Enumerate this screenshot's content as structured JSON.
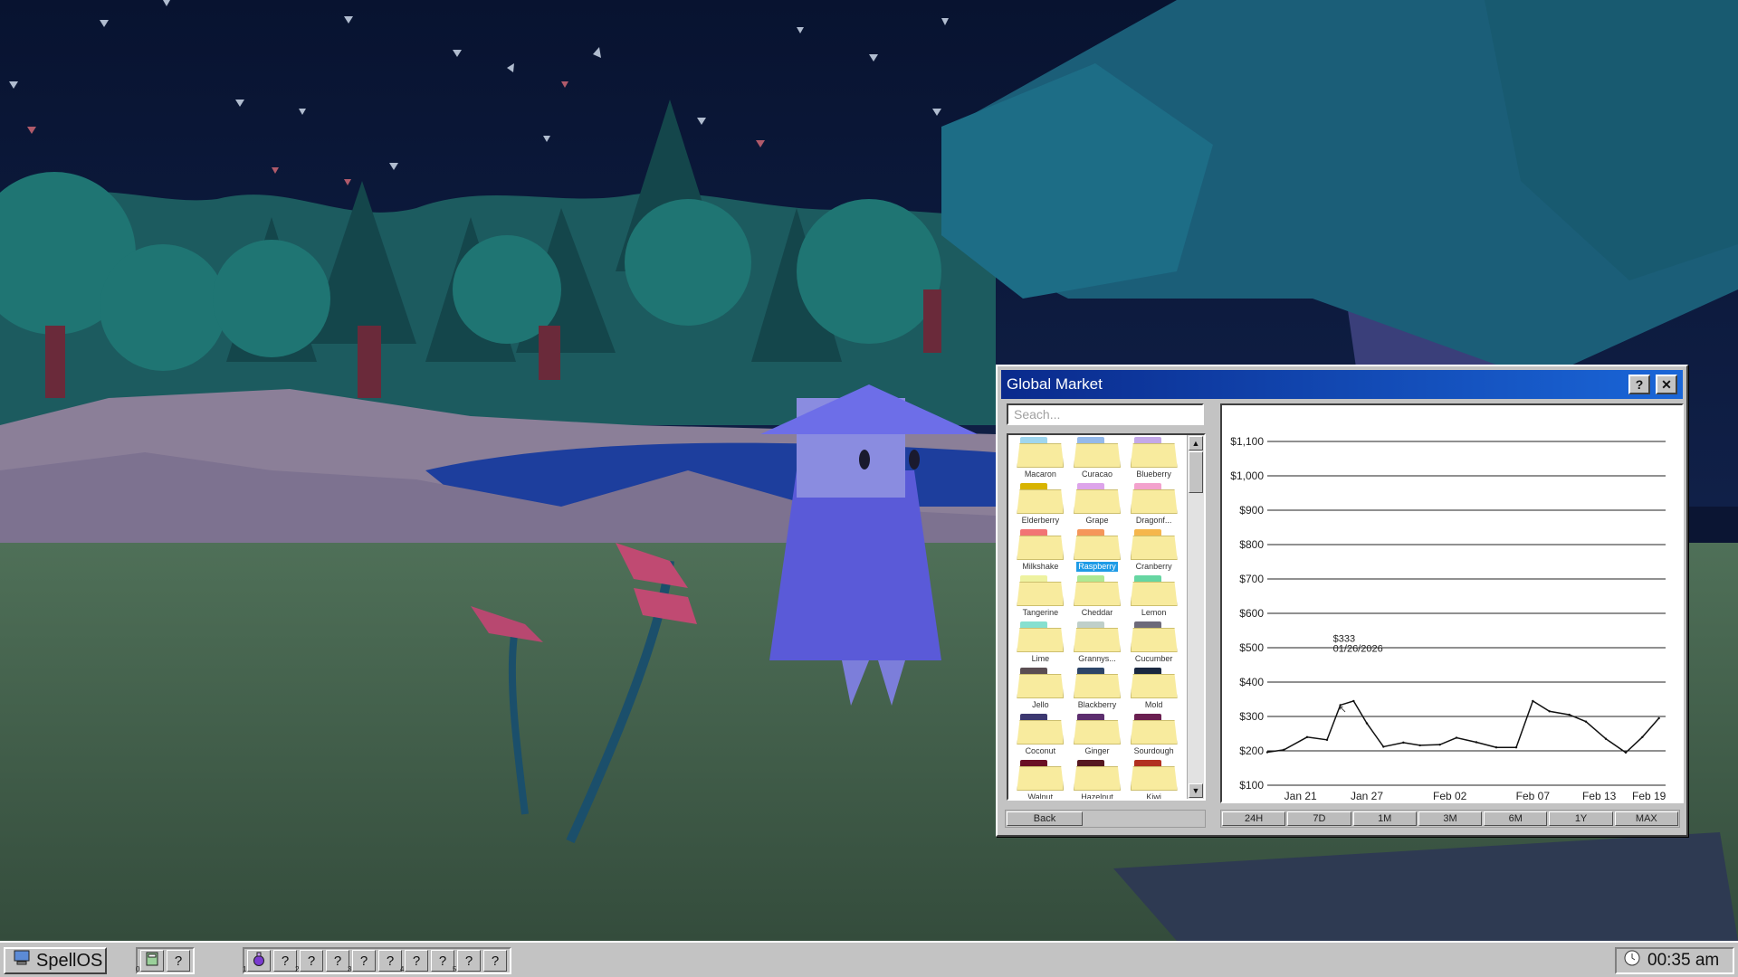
{
  "window": {
    "title": "Global Market",
    "help_label": "?",
    "close_label": "✕",
    "search_placeholder": "Seach...",
    "back_label": "Back",
    "range_buttons": [
      "24H",
      "7D",
      "1M",
      "3M",
      "6M",
      "1Y",
      "MAX"
    ],
    "items": [
      {
        "name": "Macaron",
        "color": "#9fd6ee",
        "selected": false
      },
      {
        "name": "Curacao",
        "color": "#94b9ea",
        "selected": false
      },
      {
        "name": "Blueberry",
        "color": "#c4a8e8",
        "selected": false
      },
      {
        "name": "Elderberry",
        "color": "#d8b400",
        "selected": false
      },
      {
        "name": "Grape",
        "color": "#dda4ea",
        "selected": false
      },
      {
        "name": "Dragonf...",
        "color": "#f3a2cd",
        "selected": false
      },
      {
        "name": "Milkshake",
        "color": "#f27474",
        "selected": false
      },
      {
        "name": "Raspberry",
        "color": "#f5965a",
        "selected": true
      },
      {
        "name": "Cranberry",
        "color": "#f5b64c",
        "selected": false
      },
      {
        "name": "Tangerine",
        "color": "#eef2a0",
        "selected": false
      },
      {
        "name": "Cheddar",
        "color": "#aee892",
        "selected": false
      },
      {
        "name": "Lemon",
        "color": "#66d6a2",
        "selected": false
      },
      {
        "name": "Lime",
        "color": "#86e0d0",
        "selected": false
      },
      {
        "name": "Grannys...",
        "color": "#bfcfc9",
        "selected": false
      },
      {
        "name": "Cucumber",
        "color": "#6d6a7a",
        "selected": false
      },
      {
        "name": "Jello",
        "color": "#5b4e52",
        "selected": false
      },
      {
        "name": "Blackberry",
        "color": "#2d4568",
        "selected": false
      },
      {
        "name": "Mold",
        "color": "#1a2840",
        "selected": false
      },
      {
        "name": "Coconut",
        "color": "#3c3870",
        "selected": false
      },
      {
        "name": "Ginger",
        "color": "#5c2e6e",
        "selected": false
      },
      {
        "name": "Sourdough",
        "color": "#6a1f50",
        "selected": false
      },
      {
        "name": "Walnut",
        "color": "#6a0f25",
        "selected": false
      },
      {
        "name": "Hazelnut",
        "color": "#561820",
        "selected": false
      },
      {
        "name": "Kiwi",
        "color": "#b23020",
        "selected": false
      }
    ]
  },
  "chart_data": {
    "type": "line",
    "y_ticks": [
      100,
      200,
      300,
      400,
      500,
      600,
      700,
      800,
      900,
      1000,
      1100
    ],
    "y_tick_labels": [
      "$100",
      "$200",
      "$300",
      "$400",
      "$500",
      "$600",
      "$700",
      "$800",
      "$900",
      "$1,000",
      "$1,100"
    ],
    "ylim": [
      100,
      1100
    ],
    "x_tick_labels": [
      "Jan 21",
      "Jan 27",
      "Feb 02",
      "Feb 07",
      "Feb 13",
      "Feb 19"
    ],
    "x_tick_positions": [
      1,
      3,
      5.5,
      8,
      10,
      11.5
    ],
    "xlim": [
      0,
      12
    ],
    "x": [
      0,
      0.5,
      1.2,
      1.8,
      2.2,
      2.6,
      3.0,
      3.5,
      4.1,
      4.6,
      5.2,
      5.7,
      6.3,
      6.9,
      7.5,
      8.0,
      8.5,
      9.1,
      9.6,
      10.2,
      10.8,
      11.3,
      11.8
    ],
    "y": [
      196,
      203,
      240,
      232,
      333,
      345,
      280,
      212,
      224,
      216,
      218,
      238,
      225,
      210,
      210,
      345,
      315,
      305,
      285,
      235,
      195,
      240,
      295
    ],
    "tooltip": {
      "value": "$333",
      "date": "01/26/2026",
      "x": 2.2,
      "y": 333
    },
    "grid": true
  },
  "taskbar": {
    "start_label": "SpellOS",
    "group1": [
      {
        "icon": "calculator-icon",
        "label": "",
        "num": "0"
      },
      {
        "icon": "unknown-icon",
        "label": "?",
        "num": ""
      }
    ],
    "slots": [
      {
        "icon": "potion-icon",
        "label": "",
        "num": "1"
      },
      {
        "icon": "unknown-icon",
        "label": "?",
        "num": ""
      },
      {
        "icon": "unknown-icon",
        "label": "?",
        "num": "2"
      },
      {
        "icon": "unknown-icon",
        "label": "?",
        "num": ""
      },
      {
        "icon": "unknown-icon",
        "label": "?",
        "num": "3"
      },
      {
        "icon": "unknown-icon",
        "label": "?",
        "num": ""
      },
      {
        "icon": "unknown-icon",
        "label": "?",
        "num": "4"
      },
      {
        "icon": "unknown-icon",
        "label": "?",
        "num": ""
      },
      {
        "icon": "unknown-icon",
        "label": "?",
        "num": "5"
      },
      {
        "icon": "unknown-icon",
        "label": "?",
        "num": ""
      }
    ],
    "clock": "00:35 am"
  }
}
